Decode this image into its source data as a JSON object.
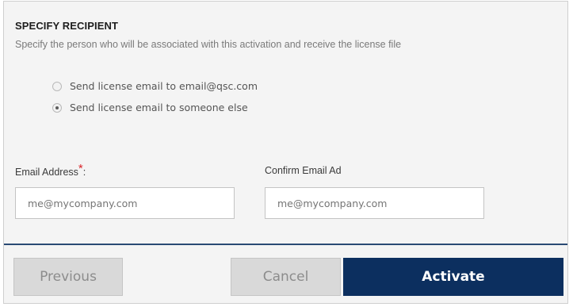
{
  "section": {
    "title": "SPECIFY RECIPIENT",
    "description": "Specify the person who will be associated with this activation and receive the license file"
  },
  "recipient_options": [
    {
      "label": "Send license email to email@qsc.com",
      "checked": false
    },
    {
      "label": "Send license email to someone else",
      "checked": true
    }
  ],
  "form": {
    "email_label": "Email Address",
    "required_marker": "*",
    "label_suffix": ":",
    "email_placeholder": "me@mycompany.com",
    "confirm_label": "Confirm Email Ad",
    "confirm_placeholder": "me@mycompany.com"
  },
  "buttons": {
    "previous": "Previous",
    "cancel": "Cancel",
    "activate": "Activate"
  },
  "colors": {
    "primary": "#0c2f5f",
    "divider": "#2a4a74",
    "required": "#d9252a",
    "panel_bg": "#f4f4f4",
    "secondary_button": "#d9d9d9"
  }
}
